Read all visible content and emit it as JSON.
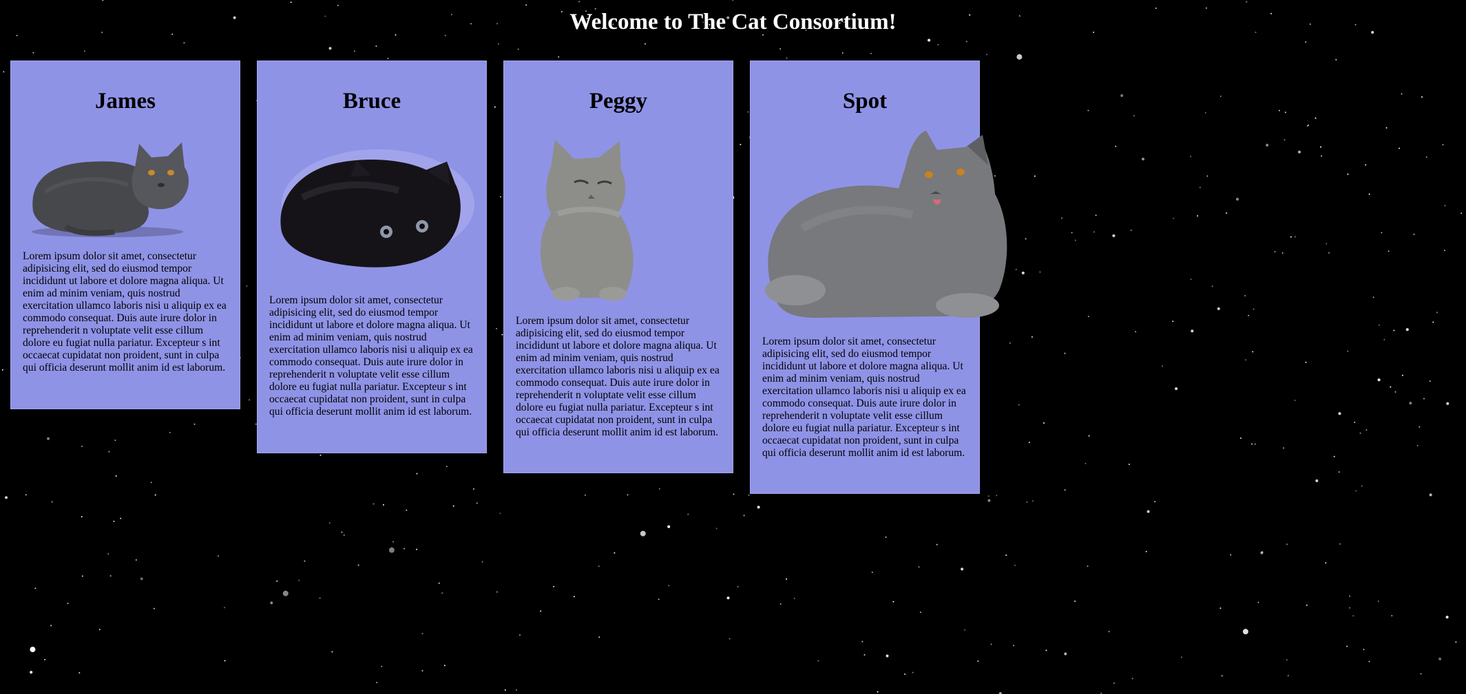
{
  "page": {
    "title": "Welcome to The Cat Consortium!"
  },
  "cats": [
    {
      "name": "James",
      "description": "Lorem ipsum dolor sit amet, consectetur adipisicing elit, sed do eiusmod tempor incididunt ut labore et dolore magna aliqua. Ut enim ad minim veniam, quis nostrud exercitation ullamco laboris nisi u aliquip ex ea commodo consequat. Duis aute irure dolor in reprehenderit n voluptate velit esse cillum dolore eu fugiat nulla pariatur. Excepteur s int occaecat cupidatat non proident, sunt in culpa qui officia deserunt mollit anim id est laborum."
    },
    {
      "name": "Bruce",
      "description": "Lorem ipsum dolor sit amet, consectetur adipisicing elit, sed do eiusmod tempor incididunt ut labore et dolore magna aliqua. Ut enim ad minim veniam, quis nostrud exercitation ullamco laboris nisi u aliquip ex ea commodo consequat. Duis aute irure dolor in reprehenderit n voluptate velit esse cillum dolore eu fugiat nulla pariatur. Excepteur s int occaecat cupidatat non proident, sunt in culpa qui officia deserunt mollit anim id est laborum."
    },
    {
      "name": "Peggy",
      "description": "Lorem ipsum dolor sit amet, consectetur adipisicing elit, sed do eiusmod tempor incididunt ut labore et dolore magna aliqua. Ut enim ad minim veniam, quis nostrud exercitation ullamco laboris nisi u aliquip ex ea commodo consequat. Duis aute irure dolor in reprehenderit n voluptate velit esse cillum dolore eu fugiat nulla pariatur. Excepteur s int occaecat cupidatat non proident, sunt in culpa qui officia deserunt mollit anim id est laborum."
    },
    {
      "name": "Spot",
      "description": "Lorem ipsum dolor sit amet, consectetur adipisicing elit, sed do eiusmod tempor incididunt ut labore et dolore magna aliqua. Ut enim ad minim veniam, quis nostrud exercitation ullamco laboris nisi u aliquip ex ea commodo consequat. Duis aute irure dolor in reprehenderit n voluptate velit esse cillum dolore eu fugiat nulla pariatur. Excepteur s int occaecat cupidatat non proident, sunt in culpa qui officia deserunt mollit anim id est laborum."
    }
  ],
  "colors": {
    "background": "#000000",
    "card": "#8f93e6",
    "title": "#ffffff"
  }
}
